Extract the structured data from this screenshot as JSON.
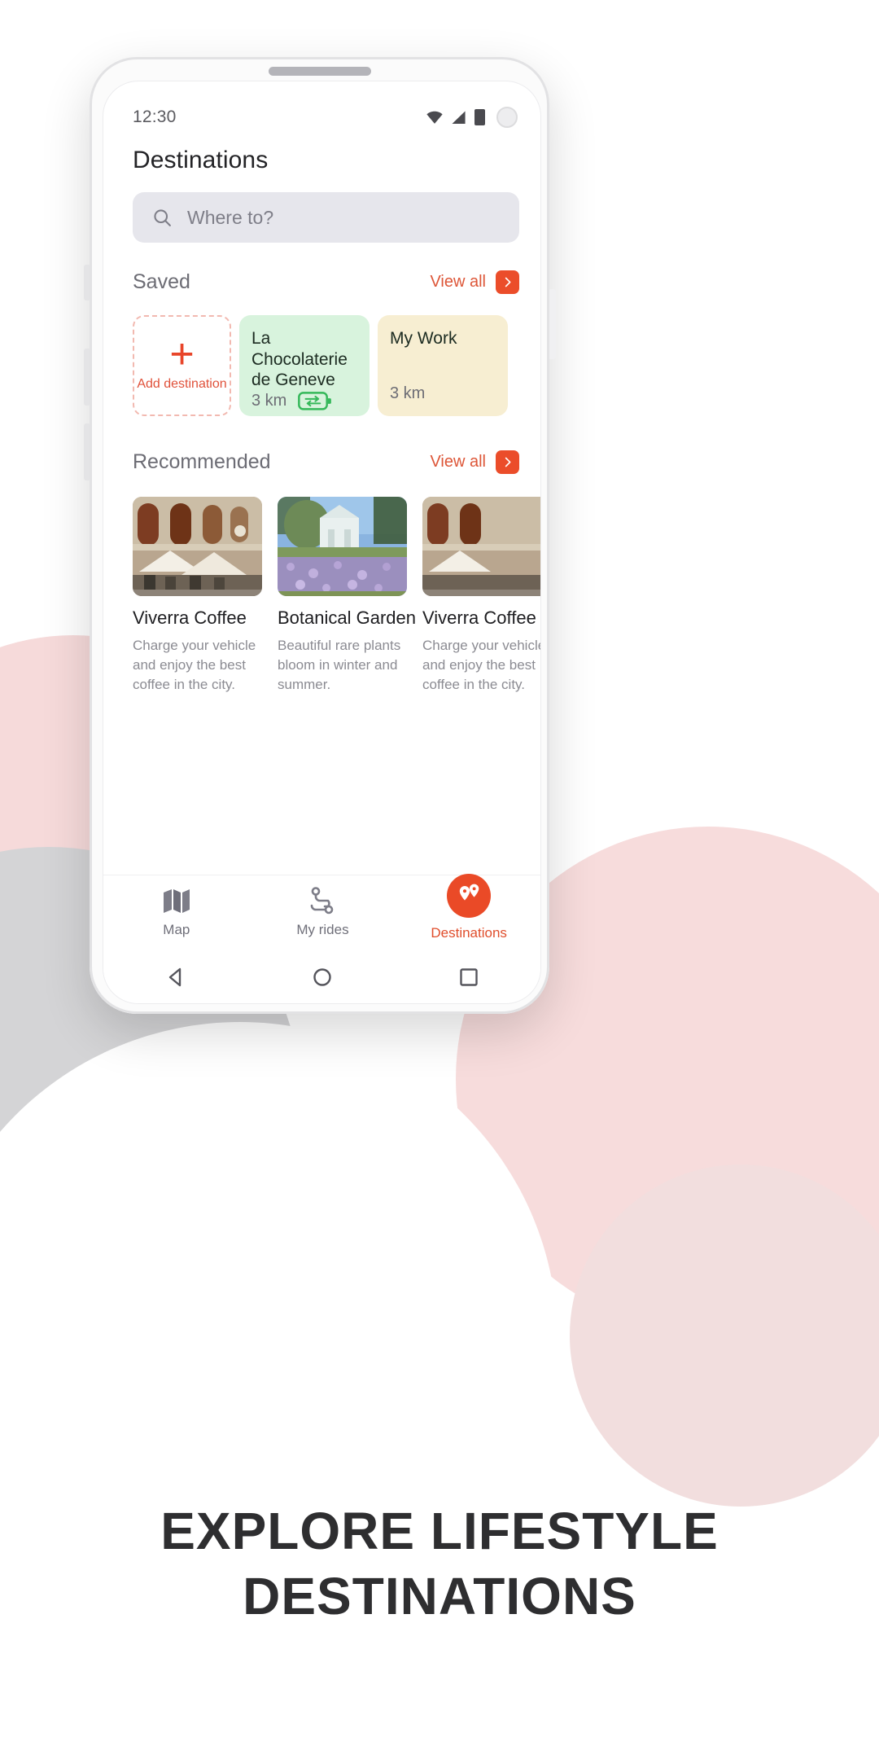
{
  "status_bar": {
    "time": "12:30",
    "icons": [
      "wifi-icon",
      "signal-icon",
      "battery-icon",
      "camera-icon"
    ]
  },
  "header": {
    "title": "Destinations"
  },
  "search": {
    "placeholder": "Where to?",
    "value": "",
    "icon": "search-icon"
  },
  "sections": [
    {
      "title": "Saved",
      "view_all_label": "View all",
      "view_all_icon": "chevron-right-icon"
    },
    {
      "title": "Recommended",
      "view_all_label": "View all",
      "view_all_icon": "chevron-right-icon"
    }
  ],
  "saved": {
    "add_card": {
      "label": "Add destination",
      "icon": "plus-icon"
    },
    "items": [
      {
        "name": "La Chocolaterie de Geneve",
        "distance": "3 km",
        "icon": "battery-swap-icon",
        "bg": "#d8f3dd"
      },
      {
        "name": "My Work",
        "distance": "3 km",
        "icon": "battery-swap-icon",
        "bg": "#f7eed2"
      }
    ]
  },
  "recommended": {
    "items": [
      {
        "title": "Viverra Coffee",
        "description": "Charge your vehicle and enjoy the best coffee in the city.",
        "image": "cafe-terrace-photo"
      },
      {
        "title": "Botanical Garden",
        "description": "Beautiful rare plants bloom in winter and summer.",
        "image": "greenhouse-garden-photo"
      },
      {
        "title": "Viverra Coffee",
        "description": "Charge your vehicle and enjoy the best coffee in the city.",
        "image": "cafe-terrace-photo"
      }
    ]
  },
  "bottom_nav": {
    "items": [
      {
        "label": "Map",
        "icon": "map-icon",
        "active": false
      },
      {
        "label": "My rides",
        "icon": "route-icon",
        "active": false
      },
      {
        "label": "Destinations",
        "icon": "map-pins-icon",
        "active": true
      }
    ]
  },
  "android_bar": {
    "icons": [
      "back-triangle-icon",
      "home-circle-icon",
      "recents-square-icon"
    ]
  },
  "caption": {
    "line1": "EXPLORE LIFESTYLE",
    "line2": "DESTINATIONS"
  },
  "colors": {
    "accent": "#ea4a27",
    "accent_text": "#dd5638",
    "green_card": "#d8f3dd",
    "cream_card": "#f7eed2",
    "search_bg": "#e6e6ec"
  }
}
